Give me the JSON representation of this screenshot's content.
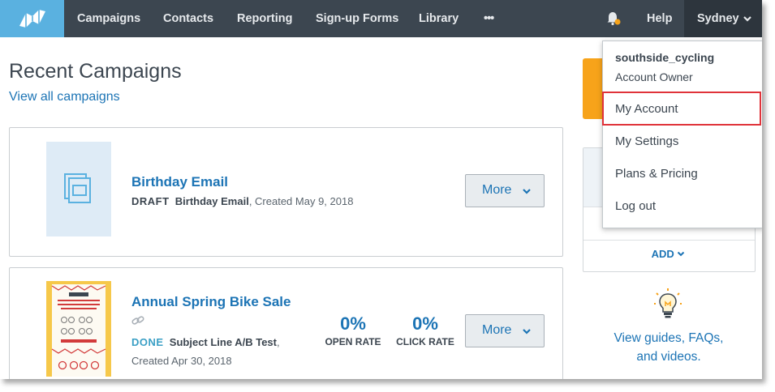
{
  "nav": {
    "items": [
      "Campaigns",
      "Contacts",
      "Reporting",
      "Sign-up Forms",
      "Library"
    ],
    "more": "•••",
    "help": "Help",
    "user": "Sydney"
  },
  "main": {
    "title": "Recent Campaigns",
    "view_all": "View all campaigns"
  },
  "campaigns": [
    {
      "title": "Birthday Email",
      "status": "DRAFT",
      "subject": "Birthday Email",
      "created": ", Created May 9, 2018",
      "more": "More"
    },
    {
      "title": "Annual Spring Bike Sale",
      "status": "DONE",
      "subject": "Subject Line A/B Test",
      "created_tail": ",",
      "created": "Created Apr 30, 2018",
      "open_rate": "0%",
      "open_label": "OPEN RATE",
      "click_rate": "0%",
      "click_label": "CLICK RATE",
      "more": "More"
    }
  ],
  "sidebar": {
    "add": "ADD",
    "guides_line1": "View guides, FAQs,",
    "guides_line2": "and videos."
  },
  "dropdown": {
    "username": "southside_cycling",
    "role": "Account Owner",
    "items": [
      "My Account",
      "My Settings",
      "Plans & Pricing",
      "Log out"
    ]
  },
  "colors": {
    "topbar": "#3c4650",
    "logo": "#5ab1e0",
    "link": "#1c74b5",
    "highlight": "#e0333a",
    "accent_orange": "#f7a31a"
  }
}
